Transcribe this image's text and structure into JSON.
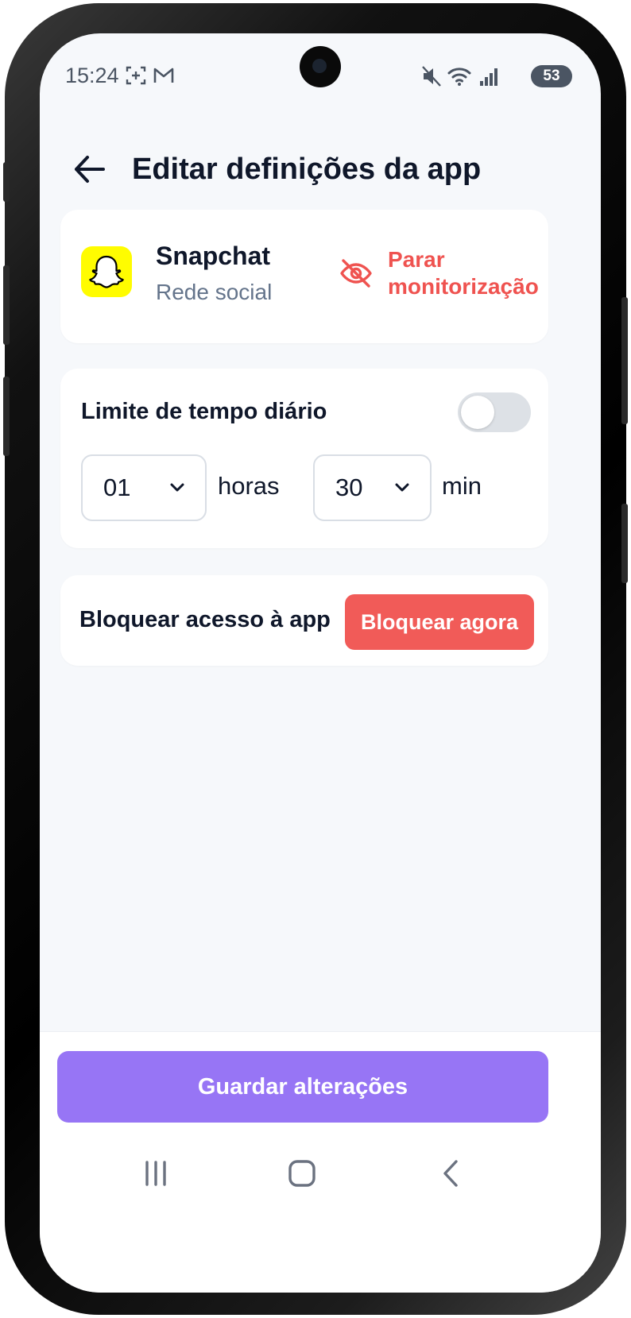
{
  "status_bar": {
    "time": "15:24",
    "battery": "53",
    "icons": [
      "screenshot-icon",
      "gmail-icon",
      "mute-icon",
      "wifi-icon",
      "signal-icon",
      "battery-icon"
    ]
  },
  "header": {
    "back_icon": "arrow-left-icon",
    "title": "Editar definições da app"
  },
  "app_card": {
    "app_name": "Snapchat",
    "category": "Rede social",
    "stop_monitoring_label": "Parar monitorização",
    "stop_icon": "eye-off-icon"
  },
  "time_limit": {
    "label": "Limite de tempo diário",
    "toggle_on": false,
    "hours_value": "01",
    "hours_unit": "horas",
    "minutes_value": "30",
    "minutes_unit": "min"
  },
  "block_access": {
    "label": "Bloquear acesso à app",
    "button_label": "Bloquear agora"
  },
  "footer": {
    "save_label": "Guardar alterações"
  },
  "nav_bar": {
    "icons": [
      "recent-apps-icon",
      "home-icon",
      "back-icon"
    ]
  },
  "colors": {
    "accent": "#9775F5",
    "danger": "#F15B58",
    "stop_text": "#EF5350",
    "snapchat": "#FFFC00",
    "title": "#0F172A"
  }
}
